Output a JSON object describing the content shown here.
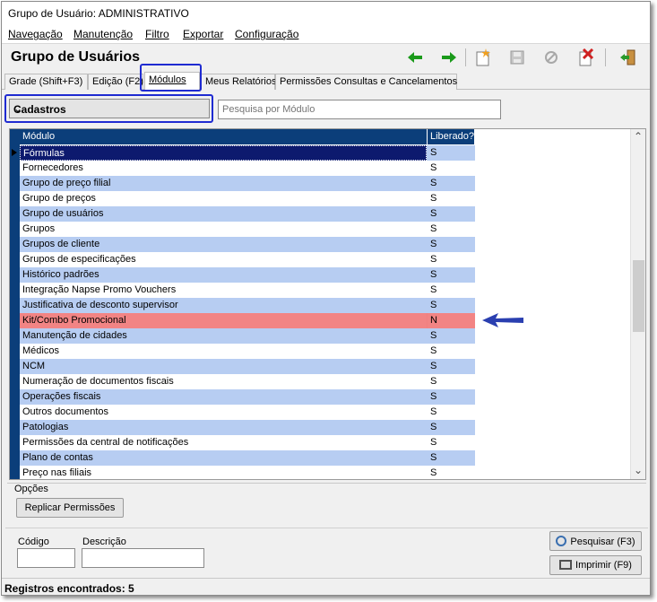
{
  "window": {
    "title": "Grupo de Usuário: ADMINISTRATIVO"
  },
  "menu": [
    "Navegação",
    "Manutenção",
    "Filtro",
    "Exportar",
    "Configuração"
  ],
  "header": {
    "title": "Grupo de Usuários"
  },
  "toolbar": {
    "icons": [
      "arrow-left-icon",
      "arrow-right-icon",
      "new-icon",
      "save-icon",
      "cancel-icon",
      "delete-icon",
      "exit-icon"
    ],
    "colors": {
      "arrows": "#1a9a1a",
      "new": "#f0a020",
      "delete": "#d02020",
      "exit": "#2a9a2a"
    }
  },
  "tabs": [
    {
      "label": "Grade (Shift+F3)"
    },
    {
      "label": "Edição (F2)"
    },
    {
      "label": "Módulos",
      "active": true
    },
    {
      "label": "Meus Relatórios"
    },
    {
      "label": "Permissões Consultas e Cancelamentos"
    }
  ],
  "filter": {
    "category": "Cadastros",
    "search_placeholder": "Pesquisa por Módulo"
  },
  "grid": {
    "columns": [
      "Módulo",
      "Liberado?"
    ],
    "rows": [
      {
        "modulo": "Fórmulas",
        "liberado": "S"
      },
      {
        "modulo": "Fornecedores",
        "liberado": "S"
      },
      {
        "modulo": "Grupo de preço filial",
        "liberado": "S"
      },
      {
        "modulo": "Grupo de preços",
        "liberado": "S"
      },
      {
        "modulo": "Grupo de usuários",
        "liberado": "S"
      },
      {
        "modulo": "Grupos",
        "liberado": "S"
      },
      {
        "modulo": "Grupos de cliente",
        "liberado": "S"
      },
      {
        "modulo": "Grupos de especificações",
        "liberado": "S"
      },
      {
        "modulo": "Histórico padrões",
        "liberado": "S"
      },
      {
        "modulo": "Integração Napse Promo Vouchers",
        "liberado": "S"
      },
      {
        "modulo": "Justificativa de desconto supervisor",
        "liberado": "S"
      },
      {
        "modulo": "Kit/Combo Promocional",
        "liberado": "N"
      },
      {
        "modulo": "Manutenção de cidades",
        "liberado": "S"
      },
      {
        "modulo": "Médicos",
        "liberado": "S"
      },
      {
        "modulo": "NCM",
        "liberado": "S"
      },
      {
        "modulo": "Numeração de documentos fiscais",
        "liberado": "S"
      },
      {
        "modulo": "Operações fiscais",
        "liberado": "S"
      },
      {
        "modulo": "Outros documentos",
        "liberado": "S"
      },
      {
        "modulo": "Patologias",
        "liberado": "S"
      },
      {
        "modulo": "Permissões da central de notificações",
        "liberado": "S"
      },
      {
        "modulo": "Plano de contas",
        "liberado": "S"
      },
      {
        "modulo": "Preço nas filiais",
        "liberado": "S"
      }
    ],
    "highlight_color": "#f28484",
    "annotation_arrow_color": "#2a3fb0"
  },
  "options": {
    "label": "Opções",
    "replicate_button": "Replicar Permissões"
  },
  "filters": {
    "codigo_label": "Código",
    "descricao_label": "Descrição",
    "search_button": "Pesquisar (F3)",
    "print_button": "Imprimir (F9)"
  },
  "status": {
    "text": "Registros encontrados: 5"
  }
}
